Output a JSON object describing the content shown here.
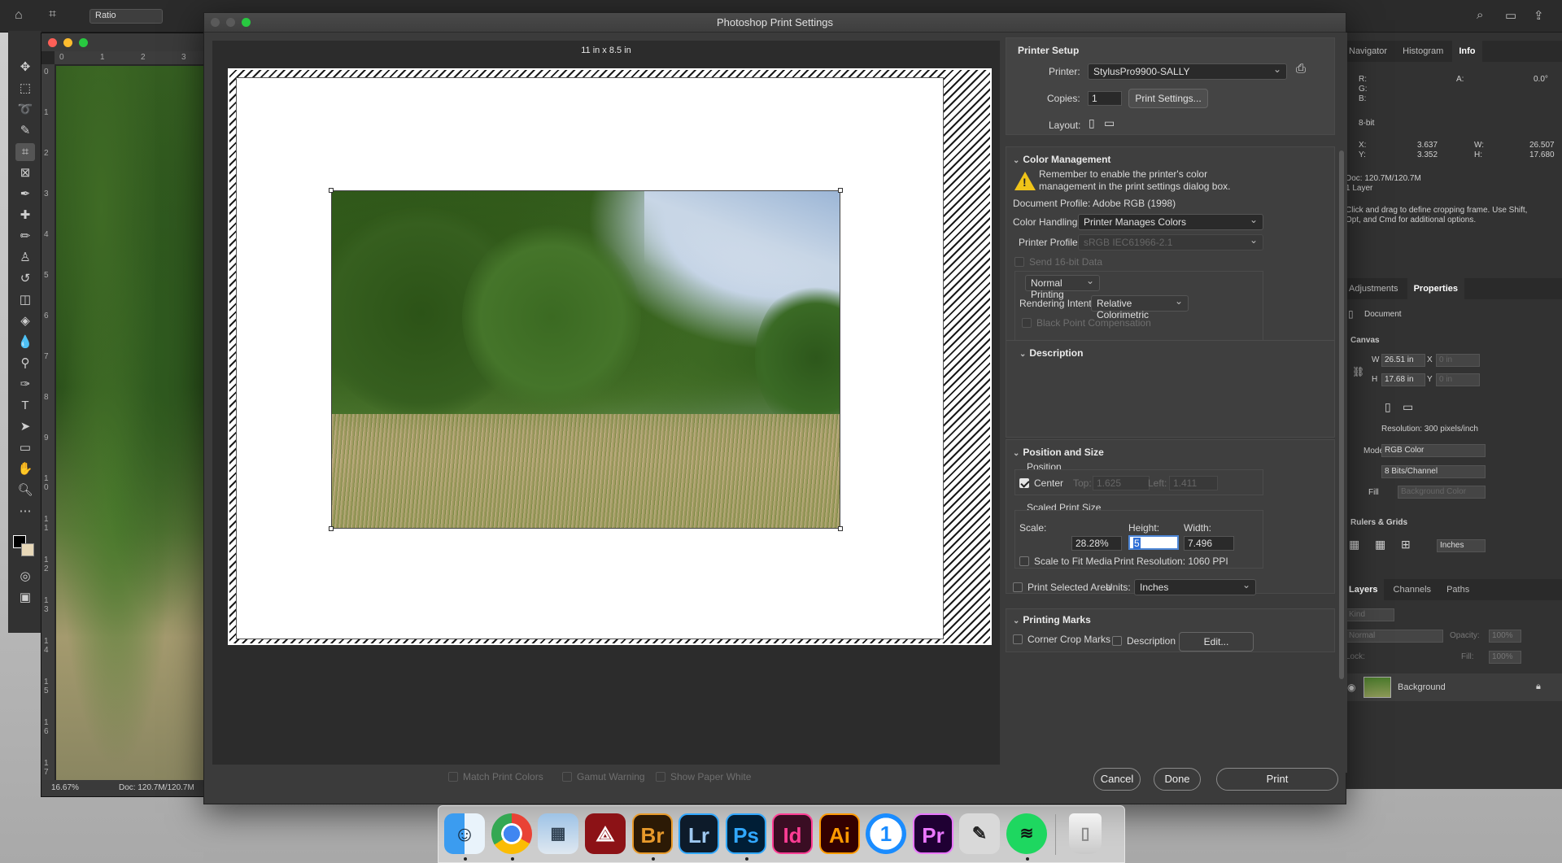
{
  "dialog": {
    "title": "Photoshop Print Settings",
    "paper_size": "11 in x 8.5 in"
  },
  "preview_options": {
    "match_print_colors": "Match Print Colors",
    "gamut_warning": "Gamut Warning",
    "show_paper_white": "Show Paper White"
  },
  "printer_setup": {
    "header": "Printer Setup",
    "printer_label": "Printer:",
    "printer_value": "StylusPro9900-SALLY",
    "copies_label": "Copies:",
    "copies_value": "1",
    "print_settings_button": "Print Settings...",
    "layout_label": "Layout:"
  },
  "color_management": {
    "header": "Color Management",
    "warning_line1": "Remember to enable the printer's color",
    "warning_line2": "management in the print settings dialog box.",
    "document_profile": "Document Profile: Adobe RGB (1998)",
    "color_handling_label": "Color Handling:",
    "color_handling_value": "Printer Manages Colors",
    "printer_profile_label": "Printer Profile:",
    "printer_profile_value": "sRGB IEC61966-2.1",
    "send_16bit": "Send 16-bit Data",
    "normal_printing": "Normal Printing",
    "rendering_intent_label": "Rendering Intent:",
    "rendering_intent_value": "Relative Colorimetric",
    "black_point": "Black Point Compensation"
  },
  "description": {
    "header": "Description"
  },
  "position_size": {
    "header": "Position and Size",
    "position_label": "Position",
    "center_label": "Center",
    "top_label": "Top:",
    "top_value": "1.625",
    "left_label": "Left:",
    "left_value": "1.411",
    "scaled_label": "Scaled Print Size",
    "scale_label": "Scale:",
    "height_label": "Height:",
    "width_label": "Width:",
    "scale_value": "28.28%",
    "height_value": "5",
    "width_value": "7.496",
    "scale_to_fit": "Scale to Fit Media",
    "print_resolution": "Print Resolution: 1060 PPI",
    "print_selected_area": "Print Selected Area",
    "units_label": "Units:",
    "units_value": "Inches"
  },
  "printing_marks": {
    "header": "Printing Marks",
    "corner_crop_marks": "Corner Crop Marks",
    "description": "Description",
    "edit_button": "Edit..."
  },
  "footer": {
    "cancel": "Cancel",
    "done": "Done",
    "print": "Print"
  },
  "options_bar": {
    "ratio": "Ratio"
  },
  "doc_window": {
    "zoom": "16.67%",
    "doc_size": "Doc: 120.7M/120.7M",
    "ruler_h": [
      "0",
      "1",
      "2",
      "3"
    ],
    "ruler_v": [
      "0",
      "1",
      "2",
      "3",
      "4",
      "5",
      "6",
      "7",
      "8",
      "9",
      "1 0",
      "1 1",
      "1 2",
      "1 3",
      "1 4",
      "1 5",
      "1 6",
      "1 7"
    ]
  },
  "right_panel": {
    "tabs_top": [
      "Navigator",
      "Histogram",
      "Info"
    ],
    "info_r": "R:",
    "info_g": "G:",
    "info_b": "B:",
    "info_a_label": "A:",
    "info_a_value": "0.0°",
    "info_bit": "8-bit",
    "info_x_label": "X:",
    "info_x_value": "3.637",
    "info_y_label": "Y:",
    "info_y_value": "3.352",
    "info_w_label": "W:",
    "info_w_value": "26.507",
    "info_h_label": "H:",
    "info_h_value": "17.680",
    "info_doc": "Doc: 120.7M/120.7M",
    "info_layer": "1 Layer",
    "info_hint1": "Click and drag to define cropping frame. Use Shift,",
    "info_hint2": "Opt, and Cmd for additional options.",
    "tabs_mid": [
      "Adjustments",
      "Properties"
    ],
    "prop_document": "Document",
    "canvas_header": "Canvas",
    "canvas_w_label": "W",
    "canvas_w_value": "26.51 in",
    "canvas_h_label": "H",
    "canvas_h_value": "17.68 in",
    "canvas_x_label": "X",
    "canvas_x_value": "0 in",
    "canvas_y_label": "Y",
    "canvas_y_value": "0 in",
    "resolution": "Resolution: 300 pixels/inch",
    "mode_label": "Mode",
    "mode_value": "RGB Color",
    "bits_value": "8 Bits/Channel",
    "fill_label": "Fill",
    "fill_value": "Background Color",
    "rulers_header": "Rulers & Grids",
    "rulers_units": "Inches",
    "tabs_bottom": [
      "Layers",
      "Channels",
      "Paths"
    ],
    "layers_kind": "Kind",
    "layers_normal": "Normal",
    "layers_opacity": "Opacity:",
    "layers_opacity_value": "100%",
    "layers_lock": "Lock:",
    "layers_fill": "Fill:",
    "layers_fill_value": "100%",
    "layer_name": "Background"
  },
  "dock": {
    "apps": [
      "Finder",
      "Chrome",
      "Preview",
      "Acrobat",
      "Br",
      "Lr",
      "Ps",
      "Id",
      "Ai",
      "1Password",
      "Pr",
      "Script Editor",
      "Spotify",
      "Trash"
    ]
  }
}
